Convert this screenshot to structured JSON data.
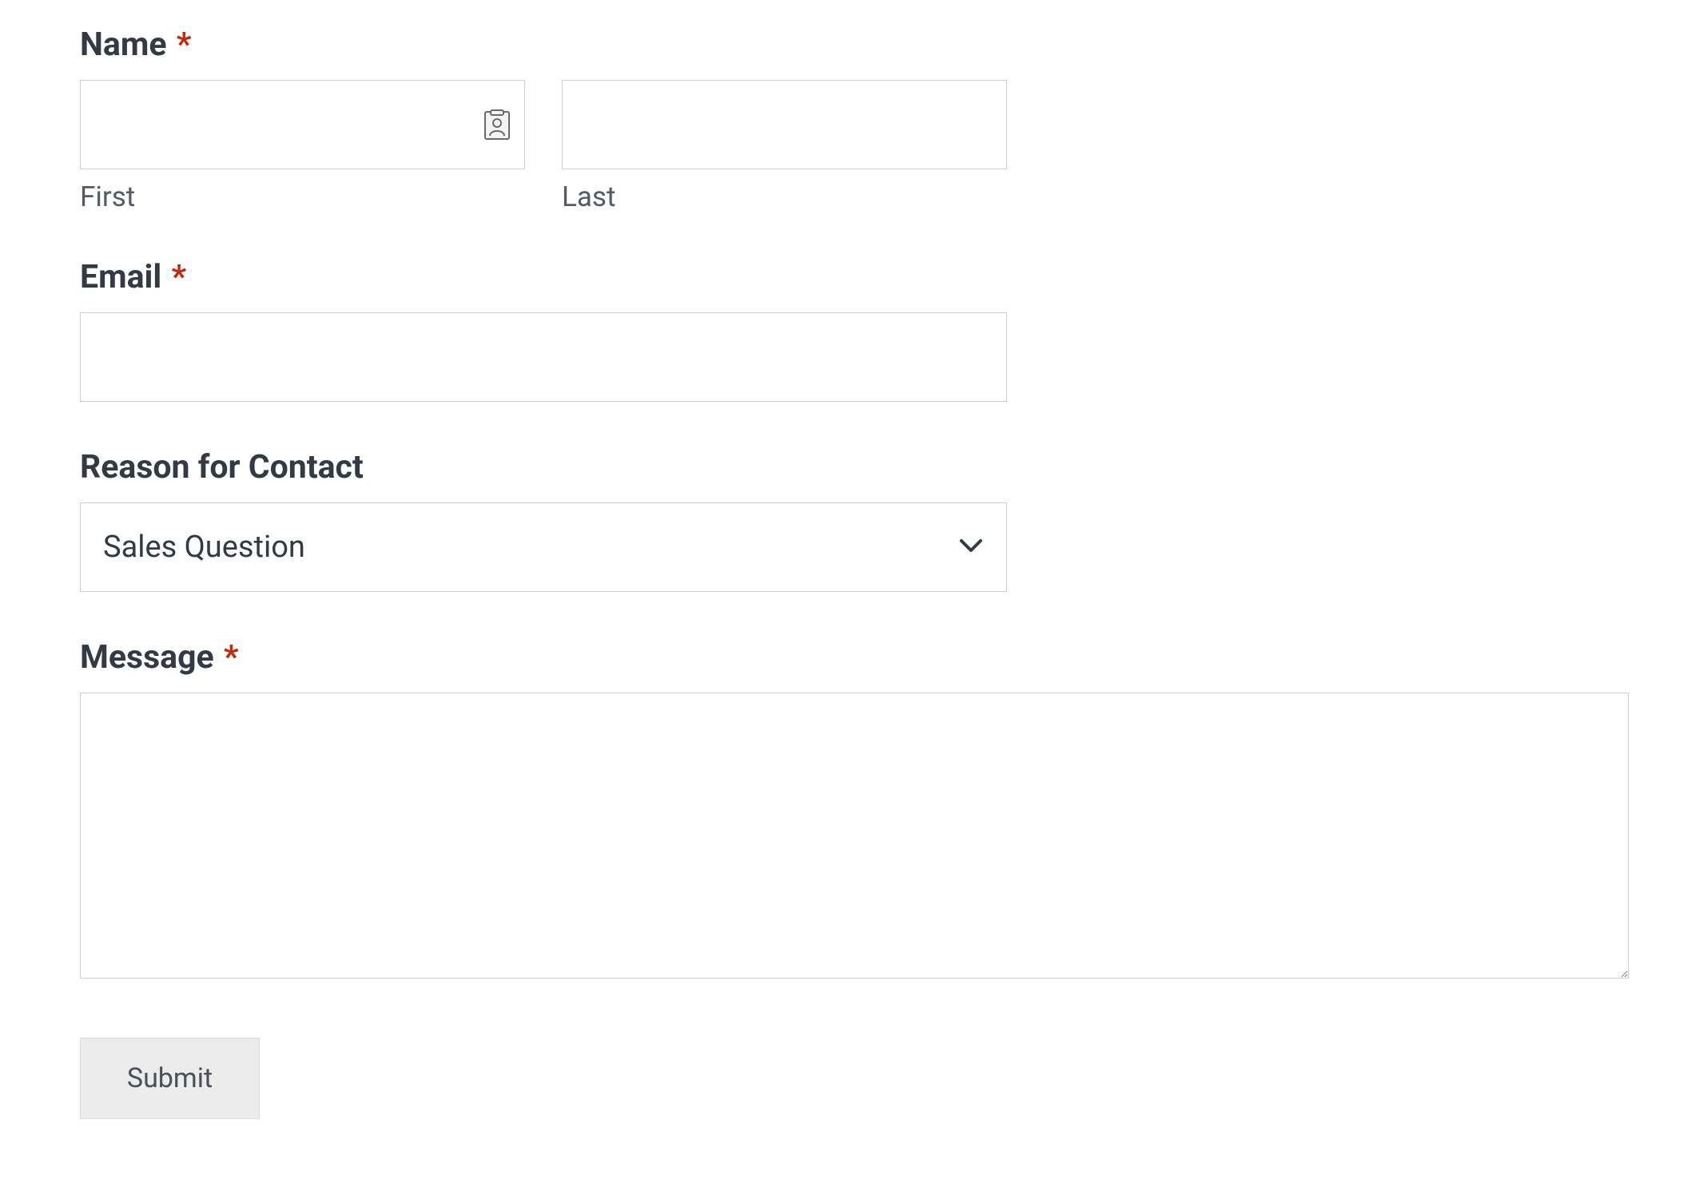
{
  "form": {
    "name": {
      "label": "Name",
      "required": "*",
      "first_sub": "First",
      "last_sub": "Last",
      "first_value": "",
      "last_value": ""
    },
    "email": {
      "label": "Email",
      "required": "*",
      "value": ""
    },
    "reason": {
      "label": "Reason for Contact",
      "selected": "Sales Question"
    },
    "message": {
      "label": "Message",
      "required": "*",
      "value": ""
    },
    "submit": {
      "label": "Submit"
    }
  }
}
